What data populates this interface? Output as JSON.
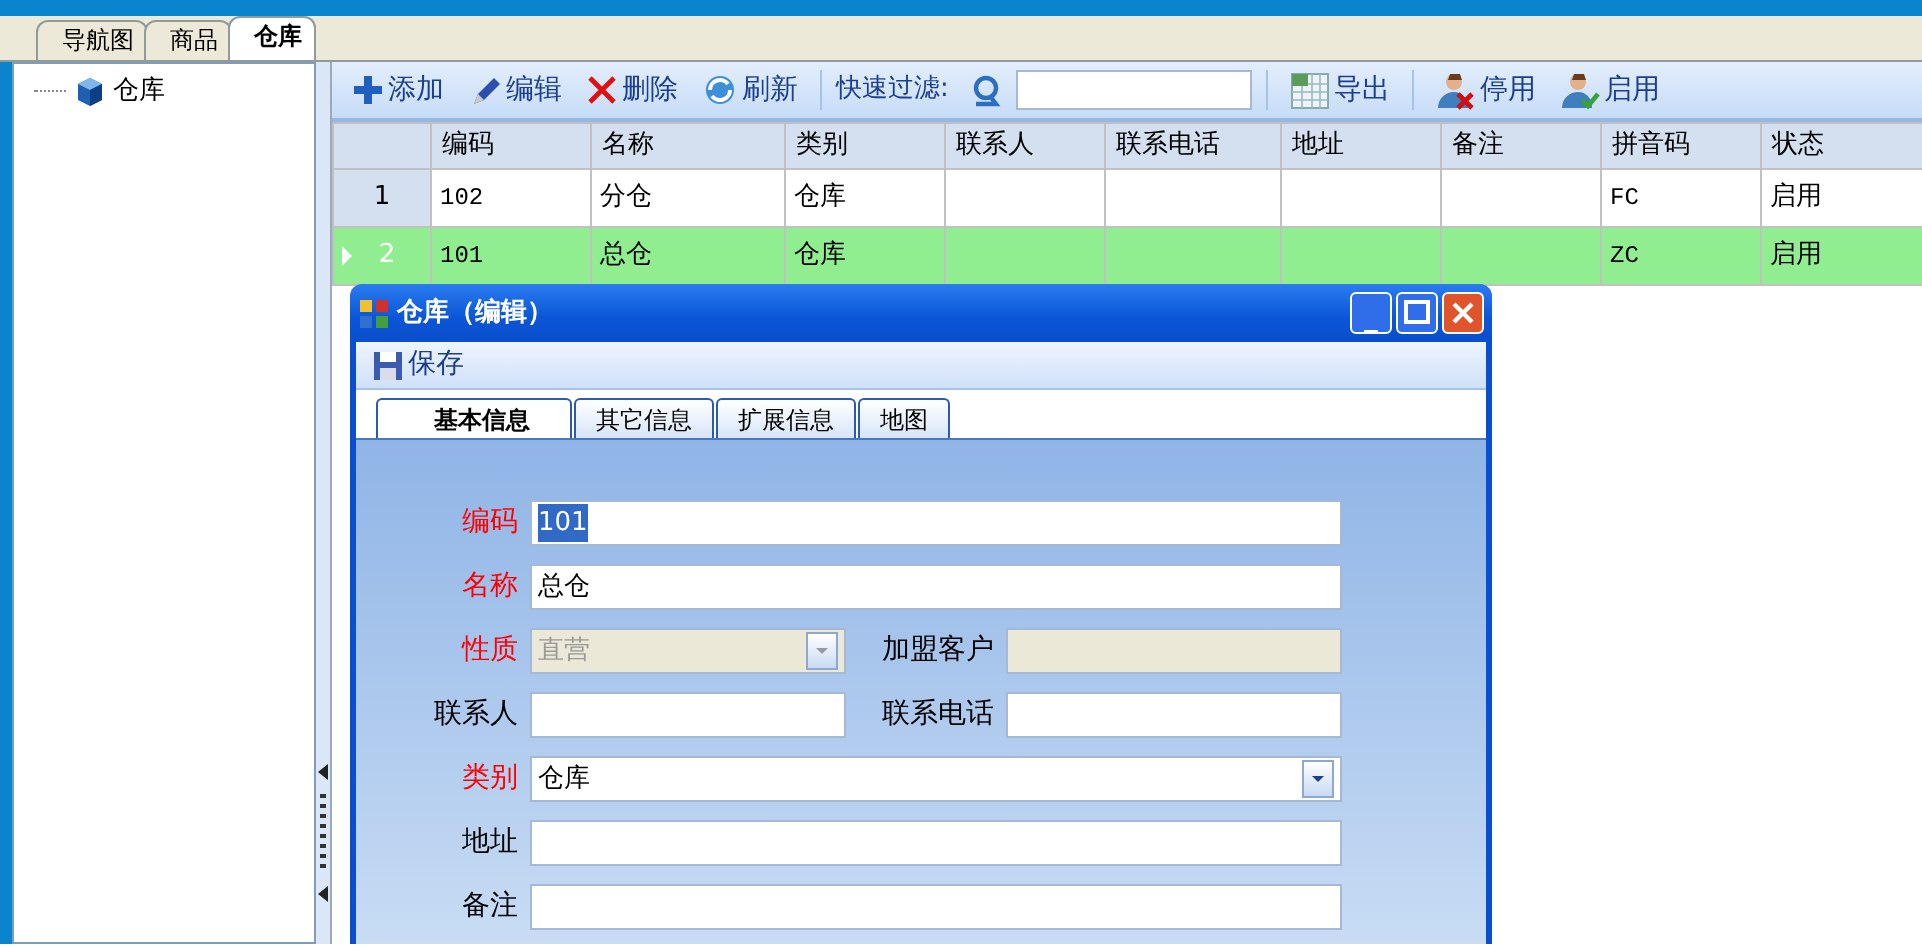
{
  "doc_tabs": [
    {
      "label": "导航图",
      "selected": false
    },
    {
      "label": "商品",
      "selected": false
    },
    {
      "label": "仓库",
      "selected": true
    }
  ],
  "tree": [
    {
      "label": "仓库"
    }
  ],
  "toolbar": [
    {
      "kind": "add",
      "label": "添加"
    },
    {
      "kind": "edit",
      "label": "编辑"
    },
    {
      "kind": "delete",
      "label": "删除"
    },
    {
      "kind": "refresh",
      "label": "刷新"
    },
    {
      "kind": "filter",
      "label": "快速过滤:"
    },
    {
      "kind": "export",
      "label": "导出"
    },
    {
      "kind": "disable",
      "label": "停用"
    },
    {
      "kind": "enable",
      "label": "启用"
    }
  ],
  "grid": {
    "columns": [
      "编码",
      "名称",
      "类别",
      "联系人",
      "联系电话",
      "地址",
      "备注",
      "拼音码",
      "状态"
    ],
    "rows": [
      {
        "index": "1",
        "selected": false,
        "cells": [
          "102",
          "分仓",
          "仓库",
          "",
          "",
          "",
          "",
          "FC",
          "启用"
        ]
      },
      {
        "index": "2",
        "selected": true,
        "cells": [
          "101",
          "总仓",
          "仓库",
          "",
          "",
          "",
          "",
          "ZC",
          "启用"
        ]
      }
    ]
  },
  "dialog": {
    "title": "仓库（编辑）",
    "toolbar": [
      {
        "label": "保存"
      }
    ],
    "tabs": [
      {
        "label": "基本信息",
        "selected": true
      },
      {
        "label": "其它信息",
        "selected": false
      },
      {
        "label": "扩展信息",
        "selected": false
      },
      {
        "label": "地图",
        "selected": false
      }
    ],
    "form_rows": [
      [
        {
          "label": "编码",
          "kind": "text",
          "required": true,
          "disabled": false,
          "value": "101",
          "text_selected": true
        }
      ],
      [
        {
          "label": "名称",
          "kind": "text",
          "required": true,
          "disabled": false,
          "value": "总仓"
        }
      ],
      [
        {
          "label": "性质",
          "kind": "select",
          "required": true,
          "disabled": true,
          "value": "直营"
        },
        {
          "label": "加盟客户",
          "kind": "text",
          "required": false,
          "disabled": true
        }
      ],
      [
        {
          "label": "联系人",
          "kind": "text",
          "required": false,
          "disabled": false
        },
        {
          "label": "联系电话",
          "kind": "text",
          "required": false,
          "disabled": false
        }
      ],
      [
        {
          "label": "类别",
          "kind": "select",
          "required": true,
          "disabled": false,
          "value": "仓库"
        }
      ],
      [
        {
          "label": "地址",
          "kind": "text",
          "required": false,
          "disabled": false
        }
      ],
      [
        {
          "label": "备注",
          "kind": "text",
          "required": false,
          "disabled": false
        }
      ]
    ]
  }
}
